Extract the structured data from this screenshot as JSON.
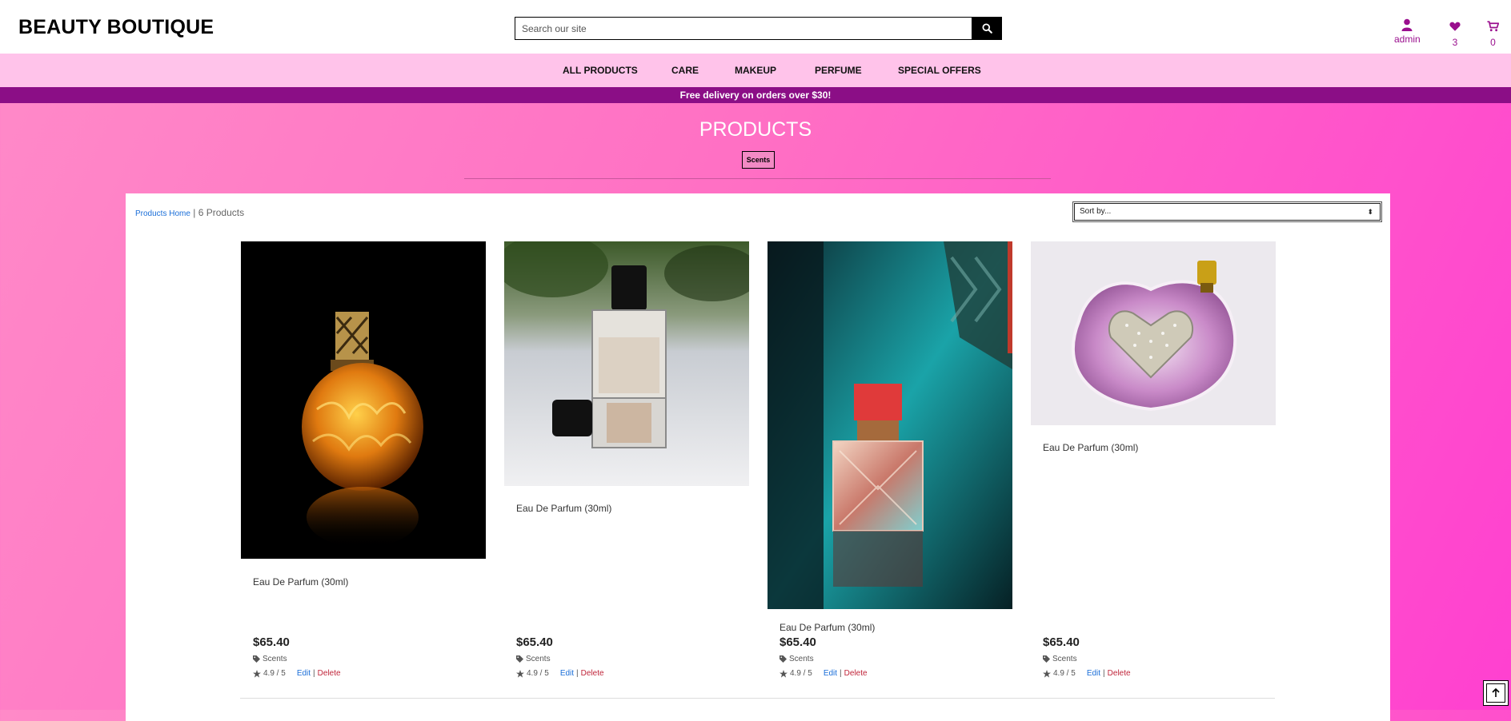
{
  "header": {
    "brand": "BEAUTY BOUTIQUE",
    "search_placeholder": "Search our site",
    "account_label": "admin",
    "wishlist_count": "3",
    "cart_count": "0"
  },
  "nav": {
    "items": [
      "ALL PRODUCTS",
      "CARE",
      "MAKEUP",
      "PERFUME",
      "SPECIAL OFFERS"
    ]
  },
  "promo": "Free delivery on orders over $30!",
  "page": {
    "title": "PRODUCTS",
    "category_badge": "Scents"
  },
  "toolbar": {
    "breadcrumb_link": "Products Home",
    "breadcrumb_sep": "|",
    "count_text": "6 Products",
    "sort_label": "Sort by..."
  },
  "products": [
    {
      "name": "Eau De Parfum (30ml)",
      "price": "$65.40",
      "category": "Scents",
      "rating": "4.9 / 5",
      "edit": "Edit",
      "delete": "Delete",
      "image": "amber-lamp-bottle"
    },
    {
      "name": "Eau De Parfum (30ml)",
      "price": "$65.40",
      "category": "Scents",
      "rating": "4.9 / 5",
      "edit": "Edit",
      "delete": "Delete",
      "image": "clear-square-bottle"
    },
    {
      "name": "Eau De Parfum (30ml)",
      "price": "$65.40",
      "category": "Scents",
      "rating": "4.9 / 5",
      "edit": "Edit",
      "delete": "Delete",
      "image": "red-cap-bottle-teal"
    },
    {
      "name": "Eau De Parfum (30ml)",
      "price": "$65.40",
      "category": "Scents",
      "rating": "4.9 / 5",
      "edit": "Edit",
      "delete": "Delete",
      "image": "crystal-heart-bottle"
    }
  ],
  "colors": {
    "accent": "#9a0f8e",
    "nav_bg": "#ffc3ea",
    "promo_bg": "#8b0e86",
    "link": "#1a6ed8",
    "delete": "#c0253a"
  },
  "icons": {
    "search": "search-icon",
    "user": "user-icon",
    "heart": "heart-icon",
    "cart": "cart-icon",
    "tag": "tag-icon",
    "star": "star-icon",
    "back_to_top": "arrow-up-icon"
  }
}
